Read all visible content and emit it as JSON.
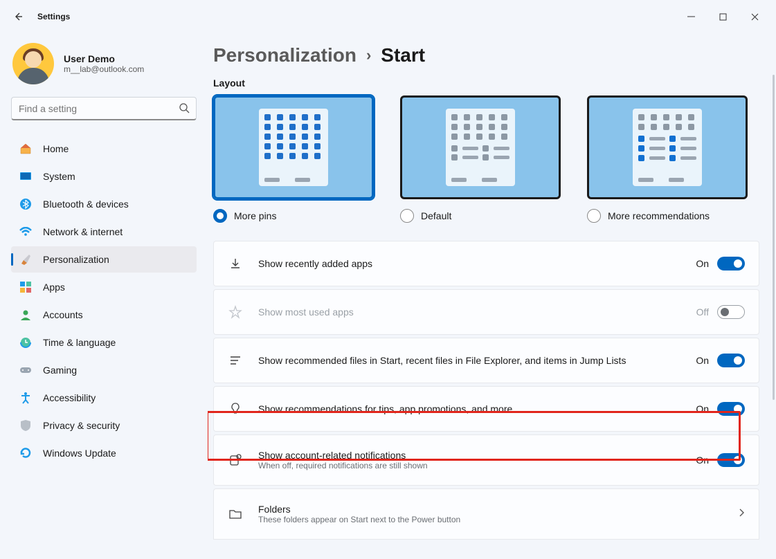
{
  "window": {
    "title": "Settings"
  },
  "user": {
    "name": "User Demo",
    "email": "m__lab@outlook.com"
  },
  "search": {
    "placeholder": "Find a setting"
  },
  "nav": [
    {
      "label": "Home"
    },
    {
      "label": "System"
    },
    {
      "label": "Bluetooth & devices"
    },
    {
      "label": "Network & internet"
    },
    {
      "label": "Personalization"
    },
    {
      "label": "Apps"
    },
    {
      "label": "Accounts"
    },
    {
      "label": "Time & language"
    },
    {
      "label": "Gaming"
    },
    {
      "label": "Accessibility"
    },
    {
      "label": "Privacy & security"
    },
    {
      "label": "Windows Update"
    }
  ],
  "breadcrumb": {
    "parent": "Personalization",
    "sep": "›",
    "current": "Start"
  },
  "layout": {
    "label": "Layout",
    "options": [
      {
        "label": "More pins",
        "selected": true
      },
      {
        "label": "Default",
        "selected": false
      },
      {
        "label": "More recommendations",
        "selected": false
      }
    ]
  },
  "settings": [
    {
      "title": "Show recently added apps",
      "state": "On",
      "enabled": true
    },
    {
      "title": "Show most used apps",
      "state": "Off",
      "enabled": false
    },
    {
      "title": "Show recommended files in Start, recent files in File Explorer, and items in Jump Lists",
      "state": "On",
      "enabled": true
    },
    {
      "title": "Show recommendations for tips, app promotions, and more",
      "state": "On",
      "enabled": true
    },
    {
      "title": "Show account-related notifications",
      "sub": "When off, required notifications are still shown",
      "state": "On",
      "enabled": true
    },
    {
      "title": "Folders",
      "sub": "These folders appear on Start next to the Power button",
      "nav": true
    }
  ]
}
